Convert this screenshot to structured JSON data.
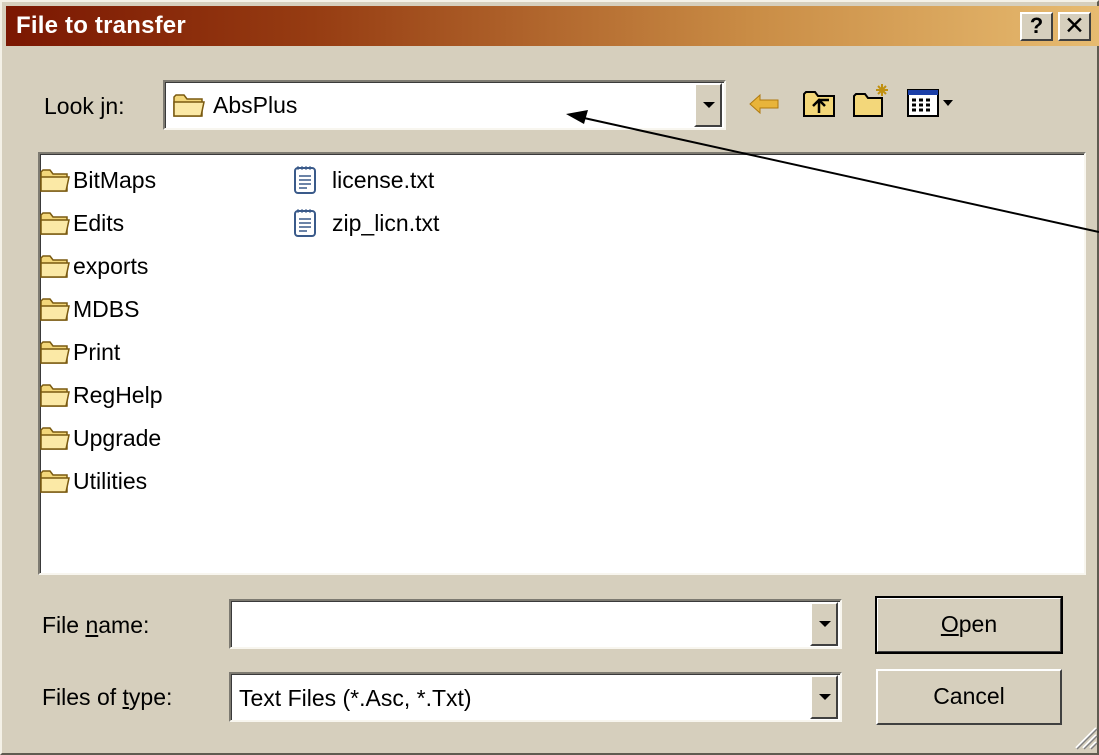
{
  "dialog": {
    "title": "File to transfer",
    "help_label": "?",
    "close_label": "✕"
  },
  "look_in": {
    "label_before": "Look ",
    "label_accel": "j",
    "label_after": "n:",
    "value": "AbsPlus"
  },
  "toolbar": {
    "icons": [
      "back-arrow-icon",
      "up-one-level-icon",
      "new-folder-icon",
      "view-menu-icon"
    ]
  },
  "files": {
    "folders": [
      "BitMaps",
      "Edits",
      "exports",
      "MDBS",
      "Print",
      "RegHelp",
      "Upgrade",
      "Utilities"
    ],
    "documents": [
      "license.txt",
      "zip_licn.txt"
    ]
  },
  "file_name": {
    "label_before": "File ",
    "label_accel": "n",
    "label_after": "ame:",
    "value": ""
  },
  "file_type": {
    "label_before": "Files of ",
    "label_accel": "t",
    "label_after": "ype:",
    "value": "Text Files (*.Asc, *.Txt)"
  },
  "buttons": {
    "open_accel": "O",
    "open_rest": "pen",
    "cancel": "Cancel"
  },
  "colors": {
    "title_start": "#7b1702",
    "title_end": "#e7bb70",
    "folder_fill": "#f3d77a",
    "dialog_face": "#d6cfbd"
  }
}
